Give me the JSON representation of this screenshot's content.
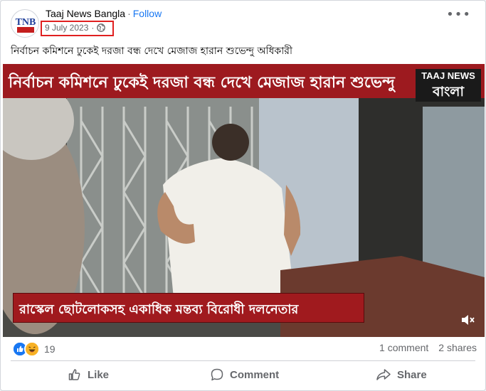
{
  "post": {
    "page_name": "Taaj News Bangla",
    "separator": "·",
    "follow_label": "Follow",
    "date": "9 July 2023",
    "date_separator": "·",
    "privacy_icon": "globe-icon",
    "more_icon": "more-options-icon",
    "more_label": "•••",
    "text": "নির্বাচন কমিশনে ঢুকেই দরজা বন্ধ দেখে মেজাজ হারান শুভেন্দু অধিকারী",
    "avatar_text": "TNB"
  },
  "media": {
    "headline": "নির্বাচন কমিশনে ঢুকেই দরজা বন্ধ দেখে মেজাজ হারান শুভেন্দু",
    "logo_top": "TAAJ NEWS",
    "logo_bottom": "বাংলা",
    "caption": "রাস্কেল ছোটলোকসহ একাধিক মন্তব্য বিরোধী দলনেতার",
    "volume_icon": "volume-muted-icon"
  },
  "stats": {
    "reaction_icons": [
      "like-icon",
      "haha-icon"
    ],
    "reaction_count": "19",
    "comments": "1 comment",
    "shares": "2 shares"
  },
  "actions": {
    "like": "Like",
    "comment": "Comment",
    "share": "Share"
  },
  "colors": {
    "follow": "#1877f2",
    "date_highlight": "#e02020",
    "headline_band": "#9d1a1f",
    "like_blue": "#1877f2",
    "haha_yellow": "#f7b125"
  }
}
